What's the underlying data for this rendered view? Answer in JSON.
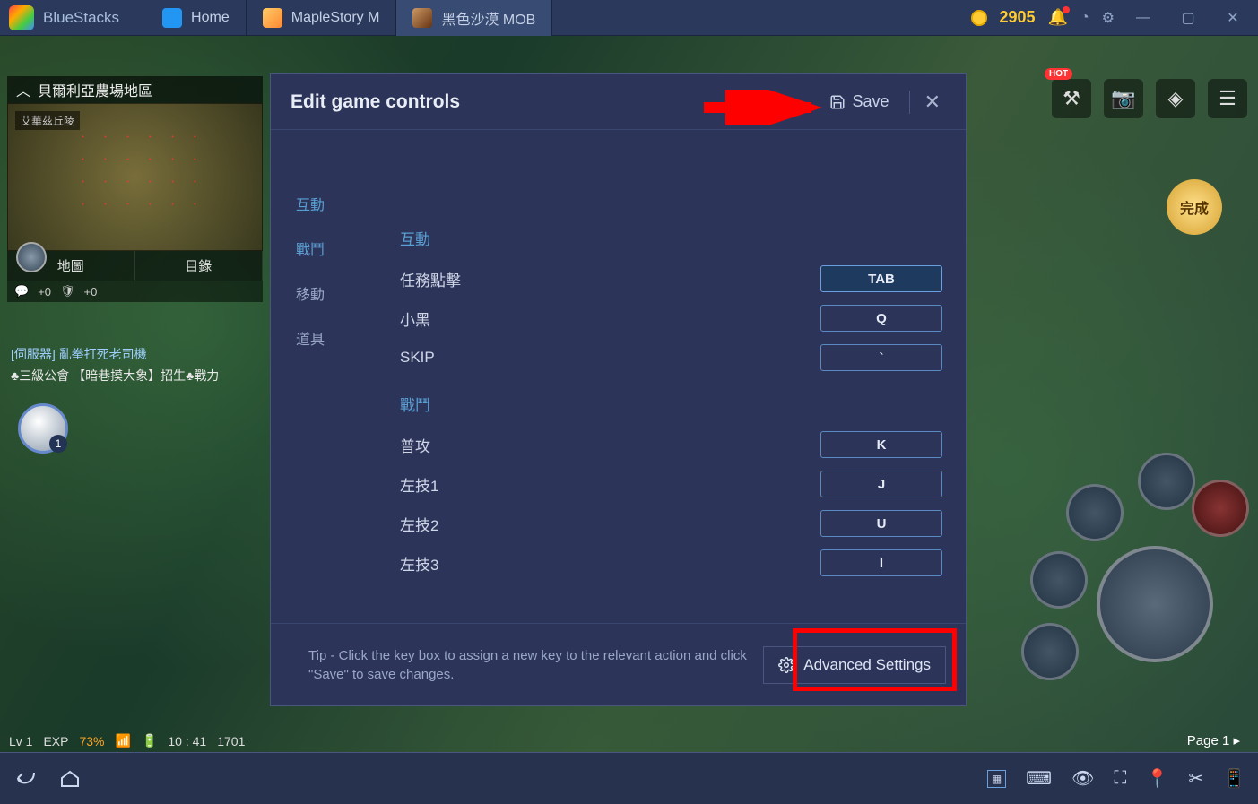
{
  "titlebar": {
    "brand": "BlueStacks",
    "tabs": [
      {
        "label": "Home"
      },
      {
        "label": "MapleStory M"
      },
      {
        "label": "黑色沙漠 MOB"
      }
    ],
    "coins": "2905"
  },
  "minimap": {
    "title": "貝爾利亞農場地區",
    "label": "艾華茲丘陵",
    "btn_map": "地圖",
    "btn_list": "目錄",
    "stat1": "+0",
    "stat2": "+0"
  },
  "chat": {
    "line1": "[伺服器] 亂拳打死老司機",
    "line2": "♣三級公會 【暗巷摸大象】招生♣戰力"
  },
  "game": {
    "level": "Lv 1",
    "exp_label": "EXP",
    "exp_pct": "73%",
    "time": "10 : 41",
    "date": "1701",
    "avatar_badge": "1",
    "page": "Page 1",
    "hot": "HOT",
    "complete": "完成"
  },
  "dialog": {
    "title": "Edit game controls",
    "save": "Save",
    "sidenav": [
      {
        "label": "互動"
      },
      {
        "label": "戰鬥"
      },
      {
        "label": "移動"
      },
      {
        "label": "道具"
      }
    ],
    "sections": [
      {
        "title": "互動",
        "rows": [
          {
            "label": "任務點擊",
            "key": "TAB",
            "selected": true
          },
          {
            "label": "小黑",
            "key": "Q"
          },
          {
            "label": "SKIP",
            "key": "`"
          }
        ]
      },
      {
        "title": "戰鬥",
        "rows": [
          {
            "label": "普攻",
            "key": "K"
          },
          {
            "label": "左技1",
            "key": "J"
          },
          {
            "label": "左技2",
            "key": "U"
          },
          {
            "label": "左技3",
            "key": "I"
          }
        ]
      }
    ],
    "tip": "Tip - Click the key box to assign a new key to the relevant action and click \"Save\" to save changes.",
    "advanced": "Advanced Settings"
  }
}
